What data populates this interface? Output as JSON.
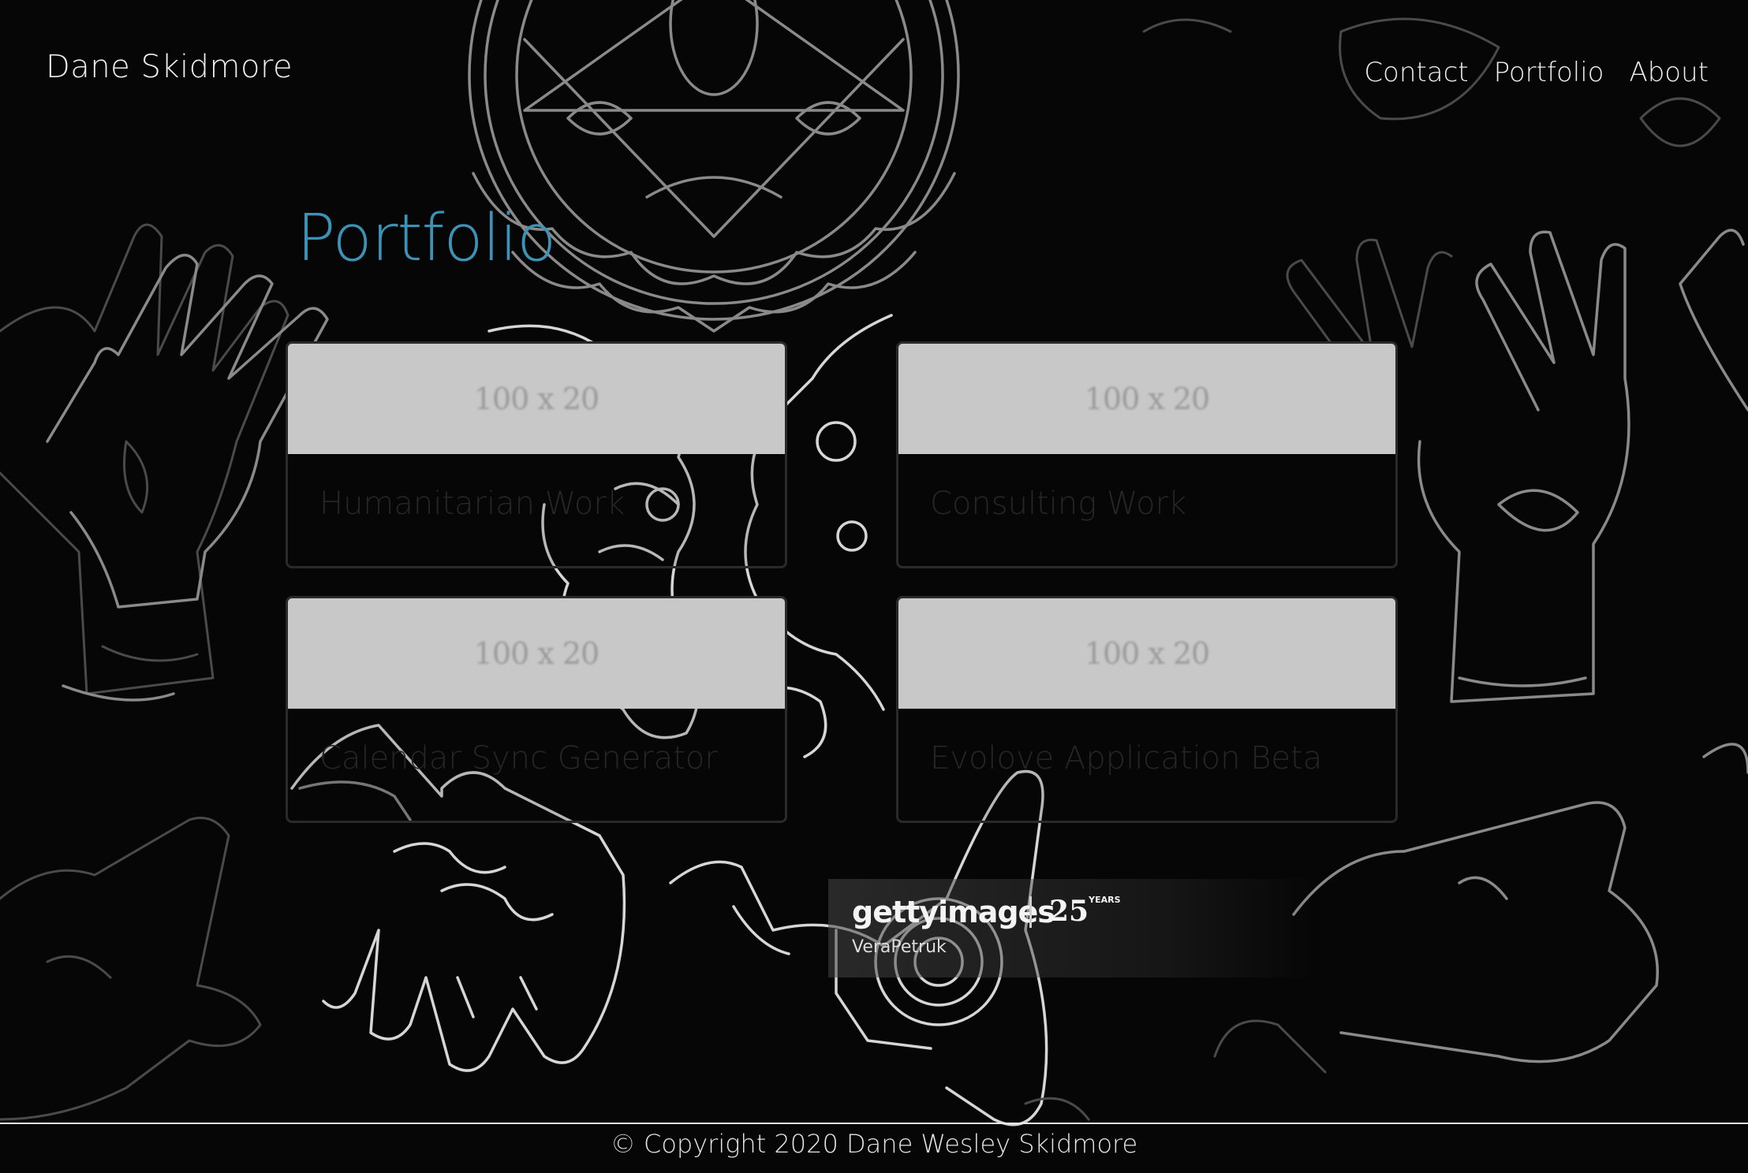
{
  "header": {
    "brand": "Dane Skidmore",
    "nav": [
      {
        "label": "Contact"
      },
      {
        "label": "Portfolio"
      },
      {
        "label": "About"
      }
    ]
  },
  "main": {
    "title": "Portfolio",
    "cards": [
      {
        "image_text": "100 x 20",
        "title": "Humanitarian Work"
      },
      {
        "image_text": "100 x 20",
        "title": "Consulting Work"
      },
      {
        "image_text": "100 x 20",
        "title": "Calendar Sync Generator"
      },
      {
        "image_text": "100 x 20",
        "title": "Evolove Application Beta"
      }
    ]
  },
  "watermark": {
    "logo": "gettyimages",
    "years": "25",
    "years_label": "YEARS",
    "credit": "VeraPetruk"
  },
  "footer": {
    "copyright": "© Copyright 2020 Dane Wesley Skidmore"
  },
  "colors": {
    "background": "#060606",
    "title_accent": "#3c93b7",
    "text": "#eeeeee",
    "card_image": "#c8c8c8"
  }
}
